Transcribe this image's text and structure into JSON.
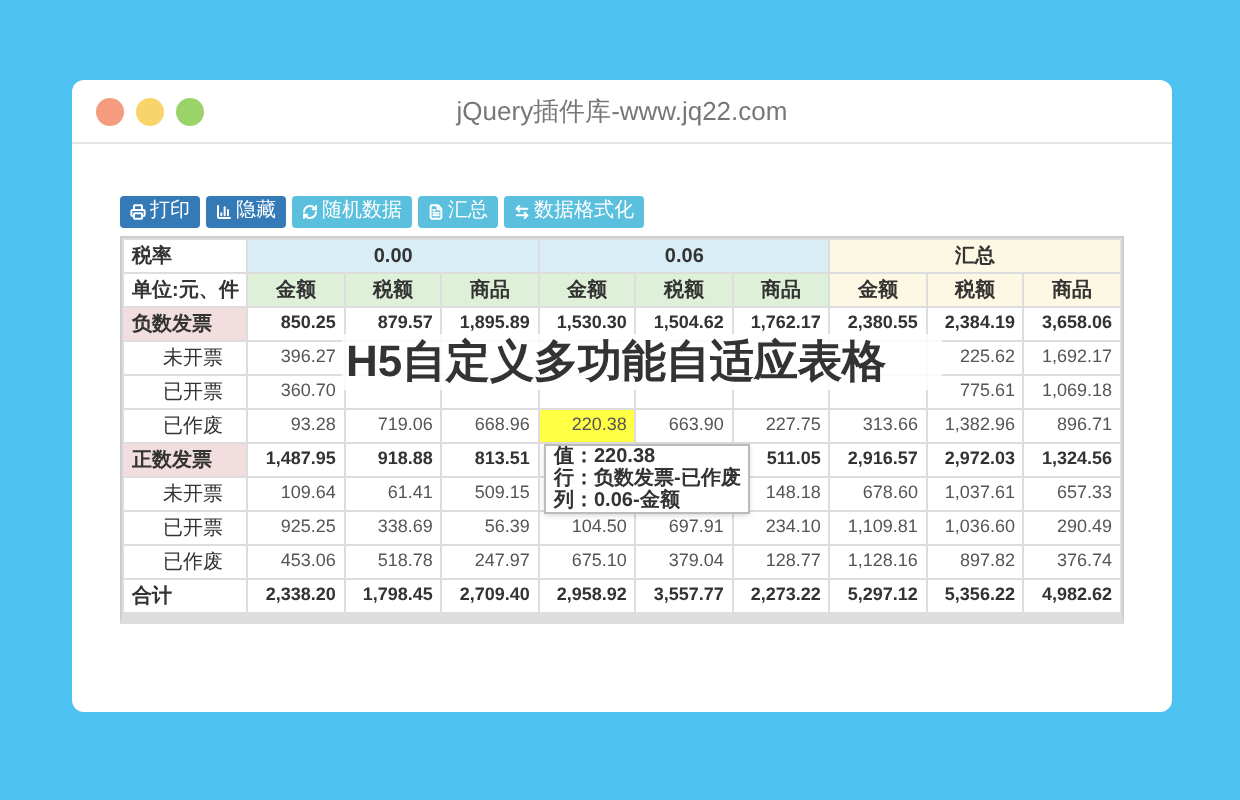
{
  "window": {
    "title": "jQuery插件库-www.jq22.com"
  },
  "toolbar": [
    {
      "label": "打印",
      "kind": "print",
      "primary": true
    },
    {
      "label": "隐藏",
      "kind": "chart",
      "primary": true
    },
    {
      "label": "随机数据",
      "kind": "refresh",
      "primary": false
    },
    {
      "label": "汇总",
      "kind": "sum",
      "primary": false
    },
    {
      "label": "数据格式化",
      "kind": "format",
      "primary": false
    }
  ],
  "table": {
    "corner_top": "税率",
    "corner_bottom": "单位:元、件",
    "groups": [
      {
        "label": "0.00",
        "color": "#d9edf7",
        "columns": [
          {
            "label": "金额",
            "color": "#dff0d8"
          },
          {
            "label": "税额",
            "color": "#dff0d8"
          },
          {
            "label": "商品",
            "color": "#dff0d8"
          }
        ]
      },
      {
        "label": "0.06",
        "color": "#d9edf7",
        "columns": [
          {
            "label": "金额",
            "color": "#dff0d8"
          },
          {
            "label": "税额",
            "color": "#dff0d8"
          },
          {
            "label": "商品",
            "color": "#dff0d8"
          }
        ]
      },
      {
        "label": "汇总",
        "color": "#fcf8e3",
        "columns": [
          {
            "label": "金额",
            "color": "#fcf8e3"
          },
          {
            "label": "税额",
            "color": "#fcf8e3"
          },
          {
            "label": "商品",
            "color": "#fcf8e3"
          }
        ]
      }
    ],
    "rows": [
      {
        "label": "负数发票",
        "kind": "group",
        "cells": [
          {
            "text": "850.25",
            "selected": false
          },
          {
            "text": "879.57",
            "selected": false
          },
          {
            "text": "1,895.89",
            "selected": false
          },
          {
            "text": "1,530.30",
            "selected": false
          },
          {
            "text": "1,504.62",
            "selected": false
          },
          {
            "text": "1,762.17",
            "selected": false
          },
          {
            "text": "2,380.55",
            "selected": false
          },
          {
            "text": "2,384.19",
            "selected": false
          },
          {
            "text": "3,658.06",
            "selected": false
          }
        ]
      },
      {
        "label": "未开票",
        "kind": "item",
        "cells": [
          {
            "text": "396.27",
            "selected": false
          },
          null,
          null,
          null,
          null,
          null,
          null,
          {
            "text": "225.62",
            "selected": false
          },
          {
            "text": "1,692.17",
            "selected": false
          }
        ]
      },
      {
        "label": "已开票",
        "kind": "item",
        "cells": [
          {
            "text": "360.70",
            "selected": false
          },
          null,
          null,
          null,
          null,
          null,
          null,
          {
            "text": "775.61",
            "selected": false
          },
          {
            "text": "1,069.18",
            "selected": false
          }
        ]
      },
      {
        "label": "已作废",
        "kind": "item",
        "cells": [
          {
            "text": "93.28",
            "selected": false
          },
          {
            "text": "719.06",
            "selected": false
          },
          {
            "text": "668.96",
            "selected": false
          },
          {
            "text": "220.38",
            "selected": true
          },
          {
            "text": "663.90",
            "selected": false
          },
          {
            "text": "227.75",
            "selected": false
          },
          {
            "text": "313.66",
            "selected": false
          },
          {
            "text": "1,382.96",
            "selected": false
          },
          {
            "text": "896.71",
            "selected": false
          }
        ]
      },
      {
        "label": "正数发票",
        "kind": "group",
        "cells": [
          {
            "text": "1,487.95",
            "selected": false
          },
          {
            "text": "918.88",
            "selected": false
          },
          {
            "text": "813.51",
            "selected": false
          },
          null,
          null,
          {
            "text": "511.05",
            "selected": false
          },
          {
            "text": "2,916.57",
            "selected": false
          },
          {
            "text": "2,972.03",
            "selected": false
          },
          {
            "text": "1,324.56",
            "selected": false
          }
        ]
      },
      {
        "label": "未开票",
        "kind": "item",
        "cells": [
          {
            "text": "109.64",
            "selected": false
          },
          {
            "text": "61.41",
            "selected": false
          },
          {
            "text": "509.15",
            "selected": false
          },
          null,
          null,
          {
            "text": "148.18",
            "selected": false
          },
          {
            "text": "678.60",
            "selected": false
          },
          {
            "text": "1,037.61",
            "selected": false
          },
          {
            "text": "657.33",
            "selected": false
          }
        ]
      },
      {
        "label": "已开票",
        "kind": "item",
        "cells": [
          {
            "text": "925.25",
            "selected": false
          },
          {
            "text": "338.69",
            "selected": false
          },
          {
            "text": "56.39",
            "selected": false
          },
          {
            "text": "104.50",
            "selected": false
          },
          {
            "text": "697.91",
            "selected": false
          },
          {
            "text": "234.10",
            "selected": false
          },
          {
            "text": "1,109.81",
            "selected": false
          },
          {
            "text": "1,036.60",
            "selected": false
          },
          {
            "text": "290.49",
            "selected": false
          }
        ]
      },
      {
        "label": "已作废",
        "kind": "item",
        "cells": [
          {
            "text": "453.06",
            "selected": false
          },
          {
            "text": "518.78",
            "selected": false
          },
          {
            "text": "247.97",
            "selected": false
          },
          {
            "text": "675.10",
            "selected": false
          },
          {
            "text": "379.04",
            "selected": false
          },
          {
            "text": "128.77",
            "selected": false
          },
          {
            "text": "1,128.16",
            "selected": false
          },
          {
            "text": "897.82",
            "selected": false
          },
          {
            "text": "376.74",
            "selected": false
          }
        ]
      },
      {
        "label": "合计",
        "kind": "total",
        "cells": [
          {
            "text": "2,338.20",
            "selected": false
          },
          {
            "text": "1,798.45",
            "selected": false
          },
          {
            "text": "2,709.40",
            "selected": false
          },
          {
            "text": "2,958.92",
            "selected": false
          },
          {
            "text": "3,557.77",
            "selected": false
          },
          {
            "text": "2,273.22",
            "selected": false
          },
          {
            "text": "5,297.12",
            "selected": false
          },
          {
            "text": "5,356.22",
            "selected": false
          },
          {
            "text": "4,982.62",
            "selected": false
          }
        ]
      }
    ]
  },
  "tooltip": [
    "值：220.38",
    "行：负数发票-已作废",
    "列：0.06-金额"
  ],
  "headline": "H5自定义多功能自适应表格"
}
